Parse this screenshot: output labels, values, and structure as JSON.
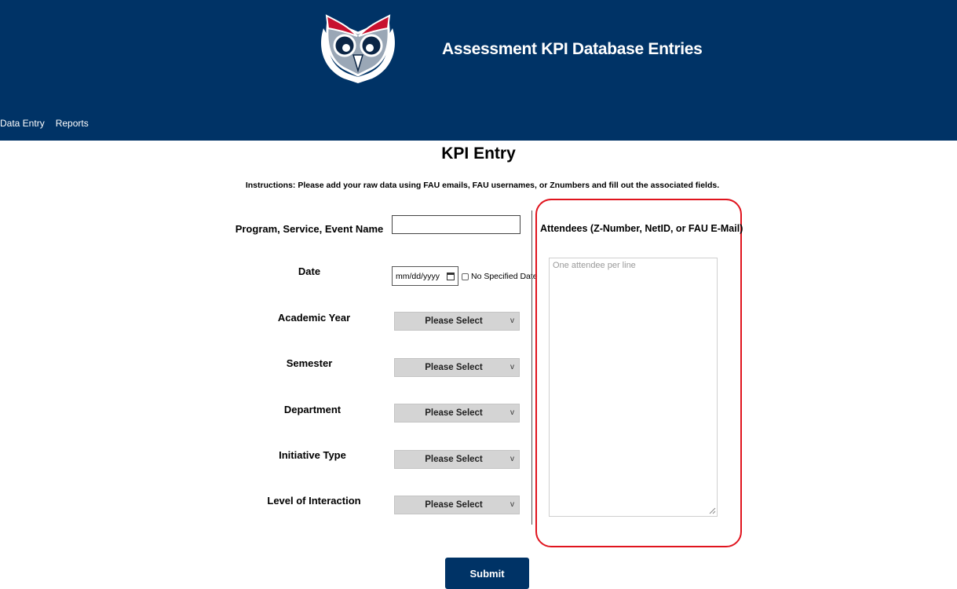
{
  "header": {
    "title": "Assessment KPI Database Entries",
    "logo_icon": "owl-logo-icon"
  },
  "nav": {
    "data_entry": "Data Entry",
    "reports": "Reports"
  },
  "main": {
    "title": "KPI Entry",
    "instructions": "Instructions: Please add your raw data using FAU emails, FAU usernames, or Znumbers and fill out the associated fields."
  },
  "form": {
    "program_label": "Program, Service, Event Name",
    "program_value": "",
    "date_label": "Date",
    "date_placeholder": "mm/dd/yyyy",
    "no_date_label": "No Specified Date",
    "academic_year_label": "Academic Year",
    "academic_year_value": "Please Select",
    "semester_label": "Semester",
    "semester_value": "Please Select",
    "department_label": "Department",
    "department_value": "Please Select",
    "initiative_type_label": "Initiative Type",
    "initiative_type_value": "Please Select",
    "level_label": "Level of Interaction",
    "level_value": "Please Select",
    "chevron": "v"
  },
  "attendees": {
    "label": "Attendees (Z-Number, NetID, or FAU E-Mail)",
    "placeholder": "One attendee per line"
  },
  "submit_label": "Submit",
  "colors": {
    "header_bg": "#003366",
    "highlight": "#e0141e",
    "owl_red": "#c8102e"
  }
}
